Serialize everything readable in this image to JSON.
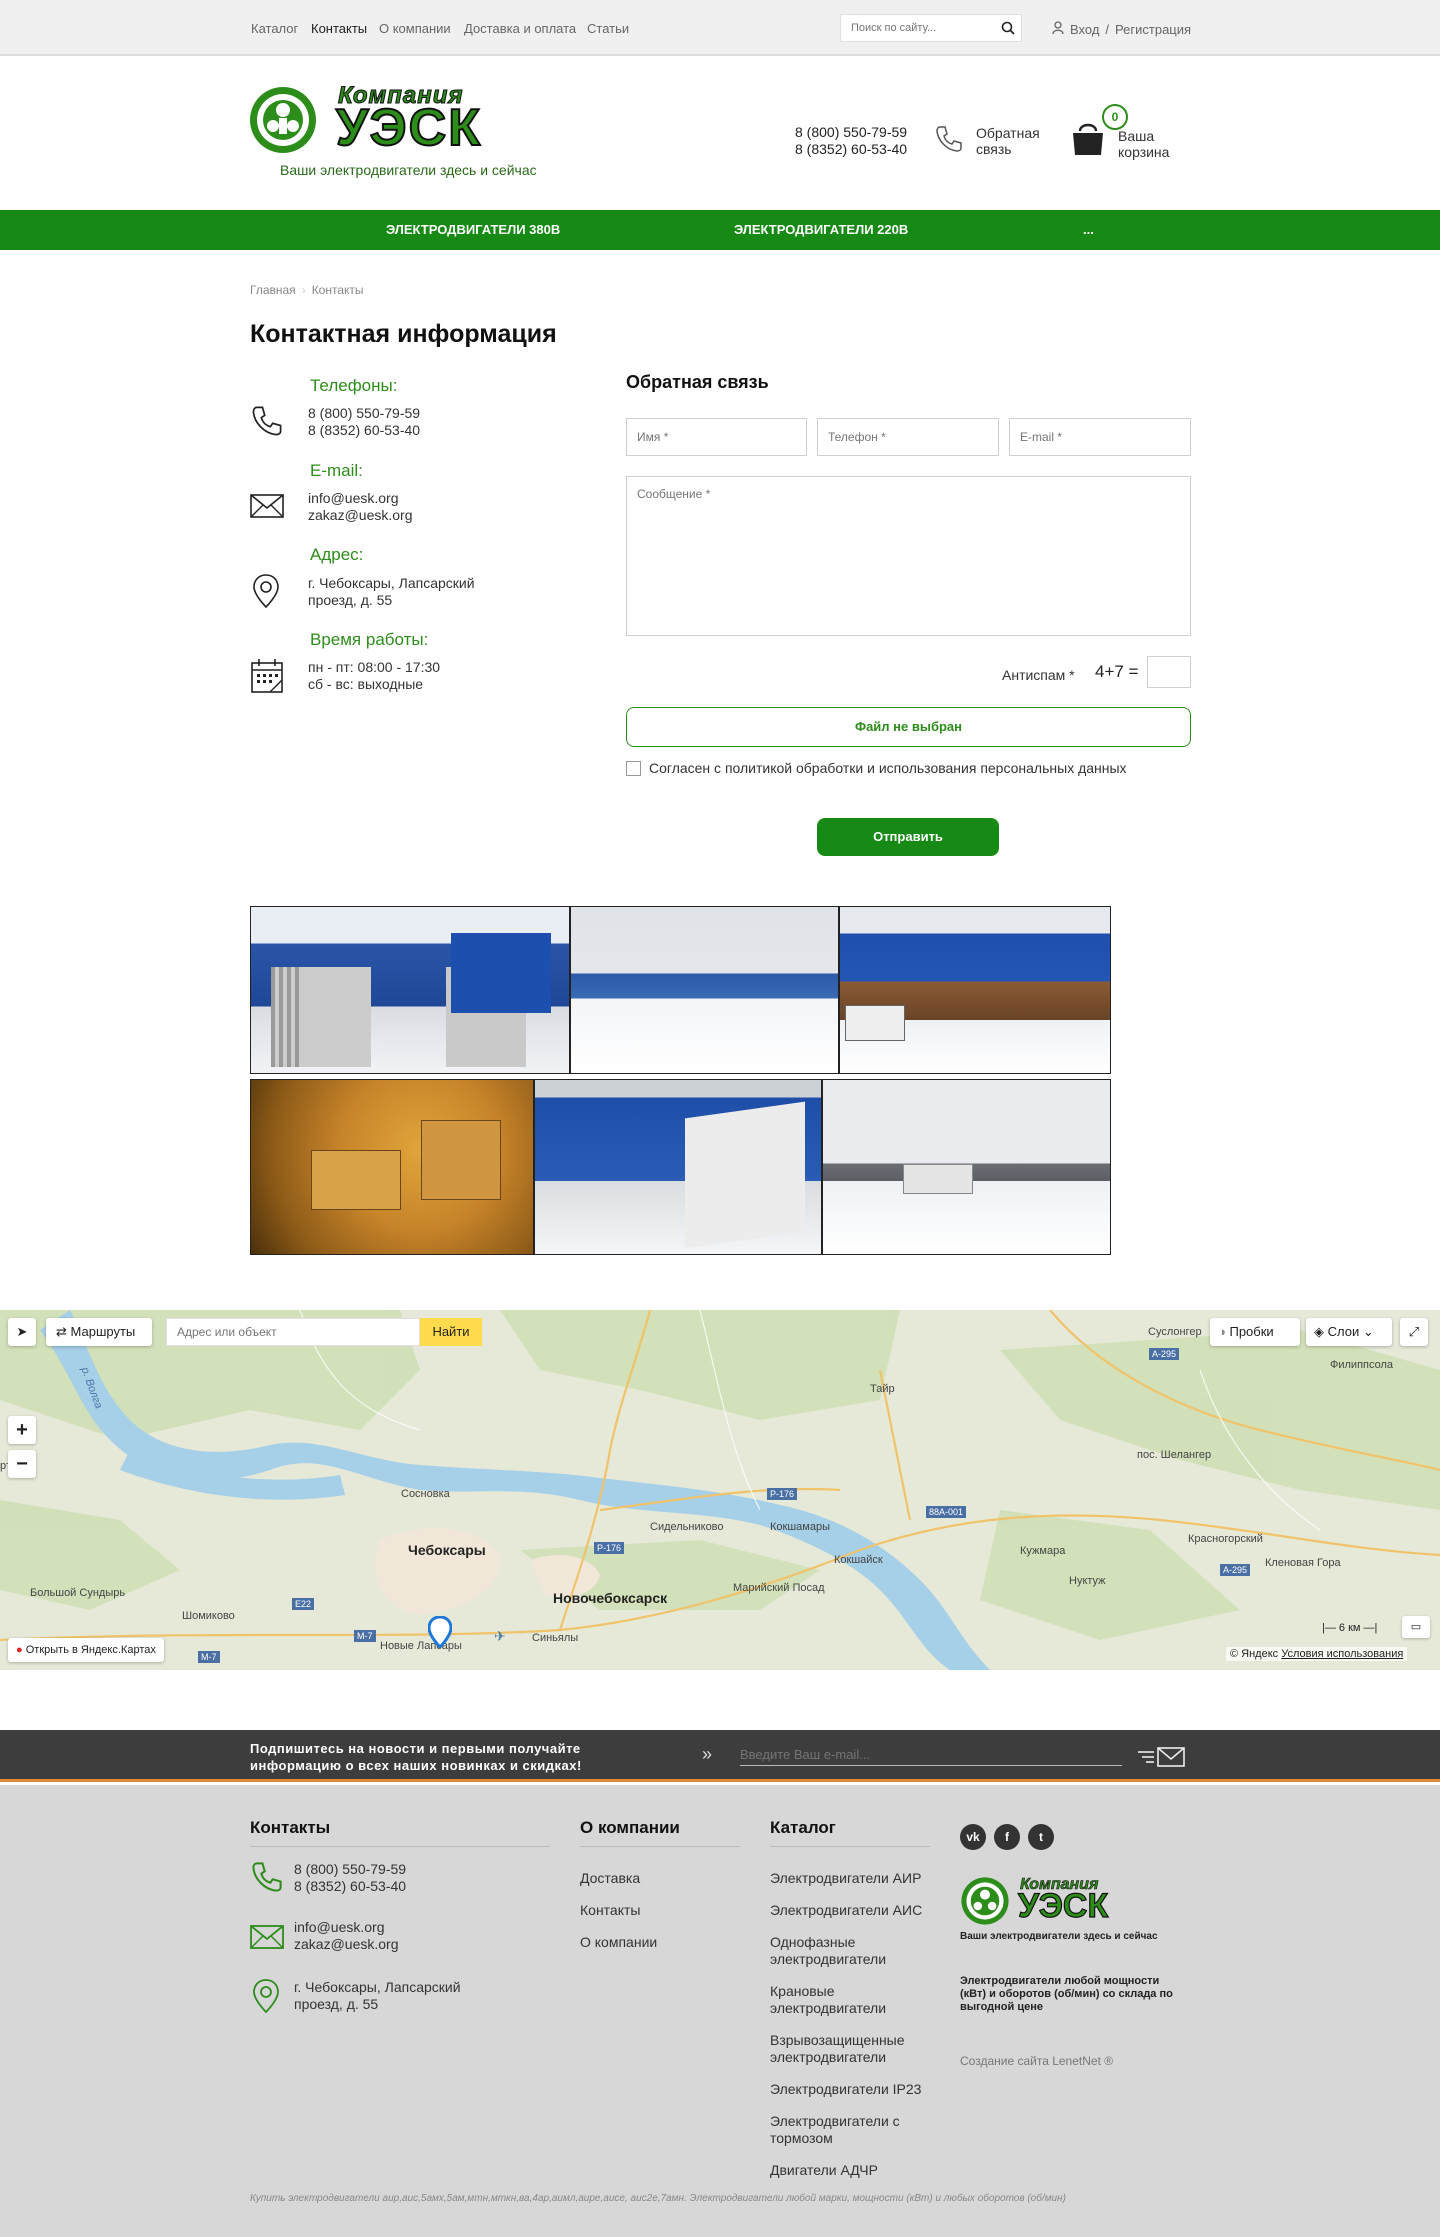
{
  "topbar": {
    "links": [
      "Каталог",
      "Контакты",
      "О компании",
      "Доставка и оплата",
      "Статьи"
    ],
    "search_placeholder": "Поиск по сайту...",
    "login": "Вход",
    "register": "Регистрация"
  },
  "header": {
    "logo_top": "Компания",
    "logo_main": "УЭСК",
    "tagline": "Ваши электродвигатели здесь и сейчас",
    "phone1": "8 (800) 550-79-59",
    "phone2": "8 (8352) 60-53-40",
    "callback": "Обратная связь",
    "cart_count": "0",
    "cart_label": "Ваша корзина"
  },
  "nav": {
    "items": [
      "ЭЛЕКТРОДВИГАТЕЛИ 380В",
      "ЭЛЕКТРОДВИГАТЕЛИ 220В",
      "..."
    ]
  },
  "breadcrumb": {
    "home": "Главная",
    "current": "Контакты"
  },
  "page_title": "Контактная информация",
  "contacts": {
    "phones_label": "Телефоны:",
    "phone1": "8 (800) 550-79-59",
    "phone2": "8 (8352) 60-53-40",
    "email_label": "E-mail:",
    "email1": "info@uesk.org",
    "email2": "zakaz@uesk.org",
    "address_label": "Адрес:",
    "address1": "г. Чебоксары, Лапсарский",
    "address2": "проезд, д. 55",
    "hours_label": "Время работы:",
    "hours1": "пн - пт: 08:00 - 17:30",
    "hours2": "сб - вс: выходные"
  },
  "form": {
    "title": "Обратная связь",
    "name_placeholder": "Имя *",
    "phone_placeholder": "Телефон *",
    "email_placeholder": "E-mail *",
    "message_placeholder": "Сообщение *",
    "antispam_label": "Антиспам *",
    "antispam_question": "4+7 =",
    "file_button": "Файл не выбран",
    "agree_text": "Согласен с политикой обработки и использования персональных данных",
    "submit": "Отправить"
  },
  "map": {
    "routes": "Маршруты",
    "search_placeholder": "Адрес или объект",
    "find": "Найти",
    "traffic": "Пробки",
    "layers": "Слои",
    "open_in": "Открыть в Яндекс.Картах",
    "copyright": "© Яндекс",
    "terms": "Условия использования",
    "scale": "6 км",
    "places": {
      "cheboksary": "Чебоксары",
      "novocheboksarsk": "Новочебоксарск",
      "sosnovka": "Сосновка",
      "sidelnikovo": "Сидельниково",
      "koshamary": "Кокшамары",
      "kokshaysk": "Кокшайск",
      "marinsky": "Марийский Посад",
      "kuzhmara": "Кужмара",
      "nuktuzh": "Нуктуж",
      "krasnogorsky": "Красногорский",
      "klenovaya": "Кленовая Гора",
      "shelanger": "пос. Шелангер",
      "filippsola": "Филиппсола",
      "suslonger": "Суслонгер",
      "tair": "Тайр",
      "shomikovo": "Шомиково",
      "bolshoy": "Большой Сундырь",
      "sinyaly": "Синьялы",
      "novye": "Новые Лапсары",
      "volga": "р. Волга",
      "ryaly": "ръялы"
    },
    "roads": [
      "P-176",
      "P-176",
      "88A-001",
      "A-295",
      "A-295",
      "M-7",
      "M-7",
      "E22"
    ]
  },
  "subscribe": {
    "text1": "Подпишитесь на новости и первыми получайте",
    "text2": "информацию о всех наших новинках и скидках!",
    "placeholder": "Введите Ваш e-mail..."
  },
  "footer": {
    "contacts_title": "Контакты",
    "phone1": "8 (800) 550-79-59",
    "phone2": "8 (8352) 60-53-40",
    "email1": "info@uesk.org",
    "email2": "zakaz@uesk.org",
    "address1": "г. Чебоксары, Лапсарский",
    "address2": "проезд, д. 55",
    "about_title": "О компании",
    "about_links": [
      "Доставка",
      "Контакты",
      "О компании"
    ],
    "catalog_title": "Каталог",
    "catalog_links": [
      "Электродвигатели АИР",
      "Электродвигатели АИС",
      "Однофазные электродвигатели",
      "Крановые электродвигатели",
      "Взрывозащищенные электродвигатели",
      "Электродвигатели IP23",
      "Электродвигатели с тормозом",
      "Двигатели АДЧР"
    ],
    "logo_top": "Компания",
    "logo_main": "УЭСК",
    "tagline": "Ваши электродвигатели здесь и сейчас",
    "description": "Электродвигатели любой мощности (кВт) и оборотов (об/мин) со склада по выгодной цене",
    "created": "Создание сайта LenetNet ®",
    "bottom": "Купить электродвигатели аир,аис,5амх,5ам,мтн,мткн,ва,4ар,аимл,аире,аисе, аис2е,7амн. Электродвигатели любой марки, мощности (кВт) и любых оборотов (об/мин)"
  },
  "colors": {
    "brand_green": "#168a14",
    "accent_orange": "#e08a3c",
    "footer_bg": "#d7d7d7"
  }
}
